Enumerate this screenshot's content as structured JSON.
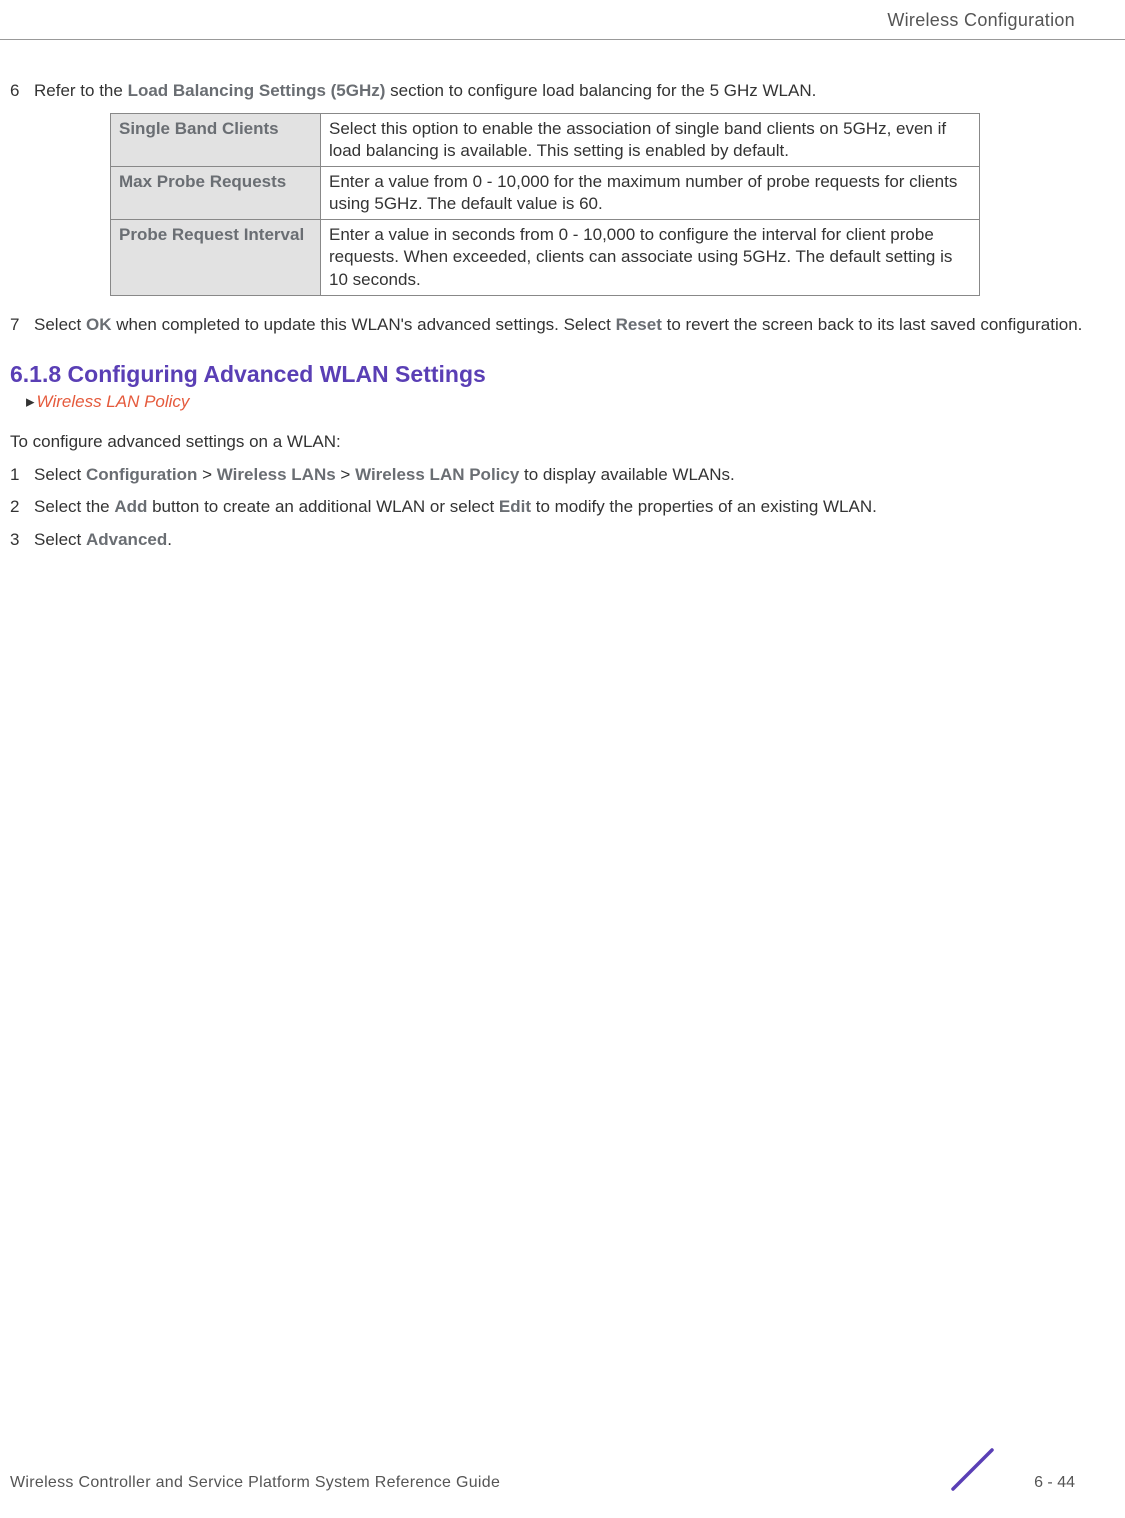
{
  "header": {
    "title": "Wireless Configuration"
  },
  "step6": {
    "num": "6",
    "pre": "Refer to the ",
    "bold": "Load Balancing Settings (5GHz)",
    "post": " section to configure load balancing for the 5 GHz WLAN."
  },
  "table": {
    "rows": [
      {
        "label": "Single Band Clients",
        "desc": "Select this option to enable the association of single band clients on 5GHz, even if load balancing is available. This setting is enabled by default."
      },
      {
        "label": "Max Probe Requests",
        "desc": "Enter a value from 0 - 10,000 for the maximum number of probe requests for clients using 5GHz. The default value is 60."
      },
      {
        "label": "Probe Request Interval",
        "desc": "Enter a value in seconds from 0 - 10,000 to configure the interval for client probe requests. When exceeded, clients can associate using 5GHz. The default setting is 10 seconds."
      }
    ]
  },
  "step7": {
    "num": "7",
    "p1": "Select ",
    "b1": "OK",
    "p2": " when completed to update this WLAN's advanced settings. Select ",
    "b2": "Reset",
    "p3": " to revert the screen back to its last saved configuration."
  },
  "section": {
    "heading": "6.1.8 Configuring Advanced WLAN Settings",
    "breadcrumb": "Wireless LAN Policy"
  },
  "intro": "To configure advanced settings on a WLAN:",
  "step1": {
    "num": "1",
    "p1": "Select ",
    "b1": "Configuration",
    "sep1": " > ",
    "b2": "Wireless LANs",
    "sep2": " > ",
    "b3": "Wireless LAN Policy",
    "p2": " to display available WLANs."
  },
  "step2": {
    "num": "2",
    "p1": "Select the ",
    "b1": "Add",
    "p2": " button to create an additional WLAN or select ",
    "b2": "Edit",
    "p3": " to modify the properties of an existing WLAN."
  },
  "step3": {
    "num": "3",
    "p1": "Select ",
    "b1": "Advanced",
    "p2": "."
  },
  "footer": {
    "title": "Wireless Controller and Service Platform System Reference Guide",
    "page": "6 - 44"
  }
}
